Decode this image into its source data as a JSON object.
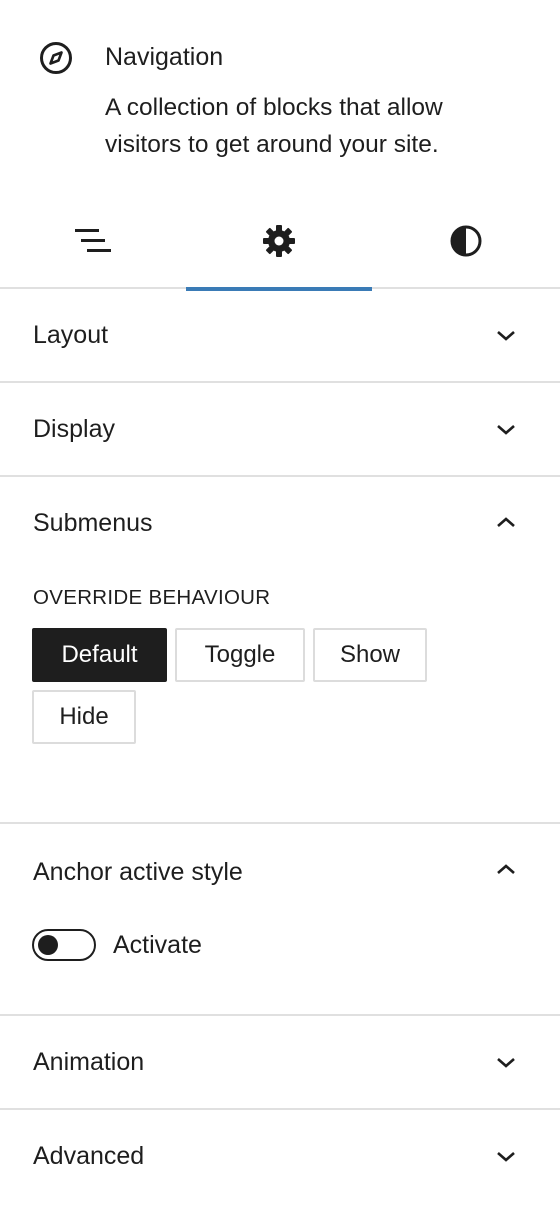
{
  "block": {
    "title": "Navigation",
    "description": "A collection of blocks that allow visitors to get around your site.",
    "icon": "compass-icon"
  },
  "tabs": [
    {
      "name": "list-view",
      "icon": "list-view-icon",
      "active": false
    },
    {
      "name": "settings",
      "icon": "gear-icon",
      "active": true
    },
    {
      "name": "styles",
      "icon": "half-circle-icon",
      "active": false
    }
  ],
  "accent_color": "#3a7bb6",
  "panels": {
    "layout": {
      "title": "Layout",
      "expanded": false
    },
    "display": {
      "title": "Display",
      "expanded": false
    },
    "submenus": {
      "title": "Submenus",
      "expanded": true,
      "override_label": "OVERRIDE BEHAVIOUR",
      "options": [
        "Default",
        "Toggle",
        "Show",
        "Hide"
      ],
      "selected": "Default"
    },
    "anchor": {
      "title": "Anchor active style",
      "expanded": true,
      "toggle_label": "Activate",
      "toggle_on": false
    },
    "animation": {
      "title": "Animation",
      "expanded": false
    },
    "advanced": {
      "title": "Advanced",
      "expanded": false
    }
  }
}
